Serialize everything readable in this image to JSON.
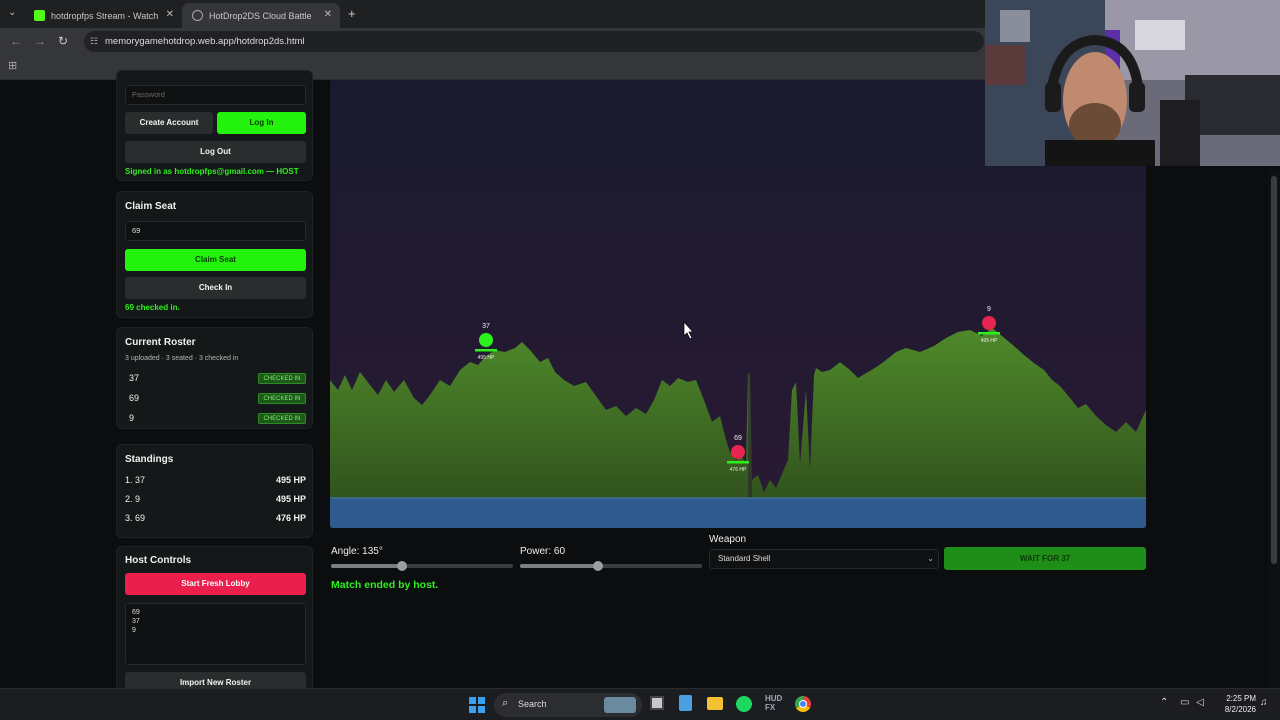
{
  "browser": {
    "tabs": [
      {
        "title": "hotdropfps Stream - Watch Live",
        "active": false
      },
      {
        "title": "HotDrop2DS Cloud Battle",
        "active": true
      }
    ],
    "url": "memorygamehotdrop.web.app/hotdrop2ds.html"
  },
  "account": {
    "password_placeholder": "Password",
    "create_account": "Create Account",
    "log_in": "Log In",
    "log_out": "Log Out",
    "signed_in": "Signed in as hotdropfps@gmail.com — HOST"
  },
  "claim_seat": {
    "title": "Claim Seat",
    "seat_value": "69",
    "claim_button": "Claim Seat",
    "check_in_button": "Check In",
    "status": "69 checked in."
  },
  "roster": {
    "title": "Current Roster",
    "summary": "3 uploaded · 3 seated · 3 checked in",
    "entries": [
      {
        "name": "37",
        "status": "CHECKED IN"
      },
      {
        "name": "69",
        "status": "CHECKED IN"
      },
      {
        "name": "9",
        "status": "CHECKED IN"
      }
    ]
  },
  "standings": {
    "title": "Standings",
    "rows": [
      {
        "label": "1. 37",
        "hp": "495 HP"
      },
      {
        "label": "2. 9",
        "hp": "495 HP"
      },
      {
        "label": "3. 69",
        "hp": "476 HP"
      }
    ]
  },
  "host_controls": {
    "title": "Host Controls",
    "start_button": "Start Fresh Lobby",
    "roster_text": "69\n37\n9",
    "import_button": "Import New Roster"
  },
  "game": {
    "players": [
      {
        "name": "37",
        "hp": "495 HP",
        "color": "#2ef01c"
      },
      {
        "name": "69",
        "hp": "476 HP",
        "color": "#e8254e"
      },
      {
        "name": "9",
        "hp": "495 HP",
        "color": "#e8254e"
      }
    ],
    "sky_color": "#1f1a2e",
    "ground_color": "#4a7a2a",
    "water_color": "#2f5a8e"
  },
  "controls": {
    "angle_label": "Angle: 135°",
    "angle_value": 135,
    "angle_fraction": 0.39,
    "power_label": "Power: 60",
    "power_value": 60,
    "power_fraction": 0.43,
    "weapon_label": "Weapon",
    "weapon_selected": "Standard Shell",
    "fire_button": "WAIT FOR 37",
    "status": "Match ended by host."
  },
  "taskbar": {
    "search": "Search",
    "time": "2:25 PM",
    "date": "8/2/2026"
  }
}
